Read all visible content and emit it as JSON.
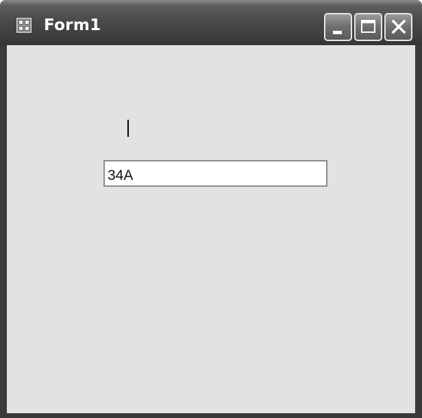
{
  "window": {
    "title": "Form1",
    "icon": "form-window-icon"
  },
  "caption_buttons": {
    "minimize_icon": "minimize-icon",
    "maximize_icon": "maximize-icon",
    "close_icon": "close-icon"
  },
  "form": {
    "textbox_value": "34A"
  },
  "colors": {
    "client_background": "#e2e2e2",
    "titlebar": "#3e3e3e",
    "textbox_border": "#8a8a8a"
  }
}
